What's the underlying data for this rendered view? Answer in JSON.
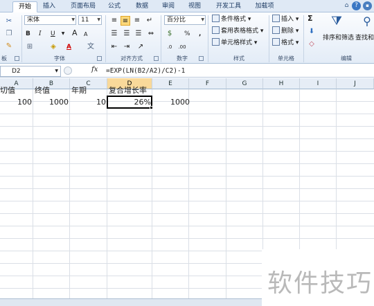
{
  "tabs": [
    "开始",
    "插入",
    "页面布局",
    "公式",
    "数据",
    "审阅",
    "视图",
    "开发工具",
    "加载项"
  ],
  "active_tab": "开始",
  "ribbon": {
    "font_name": "宋体",
    "font_size": "11",
    "bold": "B",
    "italic": "I",
    "underline": "U",
    "grow_font": "A",
    "shrink_font": "A",
    "font_color": "A",
    "number_format": "百分比",
    "percent": "%",
    "comma": ",",
    "conditional_format": "条件格式",
    "table_format": "套用表格格式",
    "cell_style": "单元格样式",
    "insert": "插入",
    "delete": "删除",
    "format": "格式",
    "sort_filter": "排序和筛选",
    "find_select": "查找和",
    "sigma": "Σ",
    "groups": {
      "clipboard": "板",
      "font": "字体",
      "alignment": "对齐方式",
      "number": "数字",
      "styles": "样式",
      "cells": "单元格",
      "editing": "编辑"
    }
  },
  "formula_bar": {
    "name_box": "D2",
    "fx": "fx",
    "formula": "=EXP(LN(B2/A2)/C2)-1"
  },
  "columns": [
    "A",
    "B",
    "C",
    "D",
    "E",
    "F",
    "G",
    "H",
    "I",
    "J"
  ],
  "selected_column": "D",
  "rows": {
    "header": [
      "切值",
      "终值",
      "年期",
      "复合增长率"
    ],
    "values": [
      "100",
      "1000",
      "10",
      "26%",
      "1000"
    ]
  },
  "watermark": "软件技巧"
}
